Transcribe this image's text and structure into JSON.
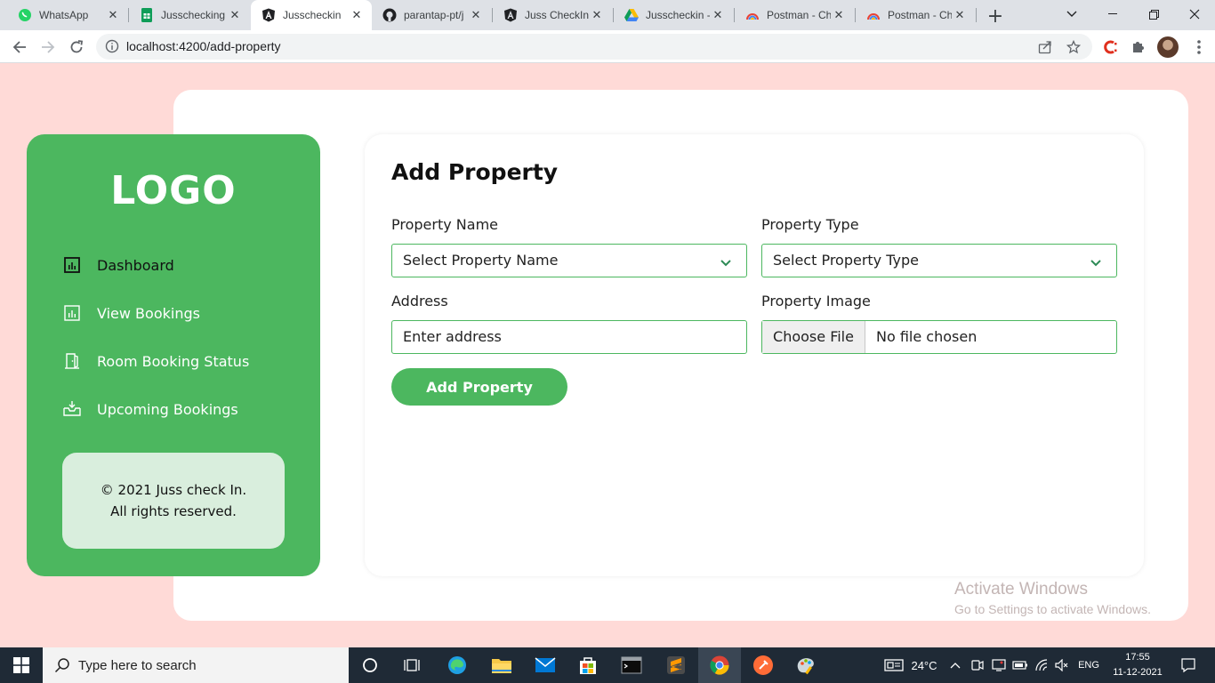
{
  "browser": {
    "tabs": [
      {
        "title": "WhatsApp",
        "icon": "whatsapp-icon",
        "active": false
      },
      {
        "title": "Jusschecking",
        "icon": "google-sheets-icon",
        "active": false
      },
      {
        "title": "Jusscheckin",
        "icon": "angular-icon",
        "active": true
      },
      {
        "title": "parantap-pt/j",
        "icon": "github-icon",
        "active": false
      },
      {
        "title": "Juss CheckIn",
        "icon": "angular-icon",
        "active": false
      },
      {
        "title": "Jusscheckin -",
        "icon": "google-drive-icon",
        "active": false
      },
      {
        "title": "Postman - Ch",
        "icon": "postman-icon",
        "active": false
      },
      {
        "title": "Postman - Ch",
        "icon": "postman-icon",
        "active": false
      }
    ],
    "url": "localhost:4200/add-property"
  },
  "sidebar": {
    "logo": "LOGO",
    "items": [
      {
        "label": "Dashboard",
        "icon": "chart-icon",
        "active": true
      },
      {
        "label": "View Bookings",
        "icon": "chart-icon",
        "active": false
      },
      {
        "label": "Room Booking Status",
        "icon": "door-icon",
        "active": false
      },
      {
        "label": "Upcoming Bookings",
        "icon": "inbox-icon",
        "active": false
      }
    ],
    "footer_line1": "© 2021 Juss check In.",
    "footer_line2": "All rights reserved."
  },
  "form": {
    "title": "Add Property",
    "property_name_label": "Property Name",
    "property_name_value": "Select Property Name",
    "property_type_label": "Property Type",
    "property_type_value": "Select Property Type",
    "address_label": "Address",
    "address_placeholder": "Enter address",
    "image_label": "Property Image",
    "choose_file": "Choose File",
    "file_status": "No file chosen",
    "submit": "Add Property"
  },
  "watermark": {
    "line1": "Activate Windows",
    "line2": "Go to Settings to activate Windows."
  },
  "taskbar": {
    "search_placeholder": "Type here to search",
    "temperature": "24°C",
    "language": "ENG",
    "time": "17:55",
    "date": "11-12-2021"
  },
  "colors": {
    "brand_green": "#4cb75f",
    "page_background": "#ffdad7",
    "footer_box": "#d9eedd"
  }
}
